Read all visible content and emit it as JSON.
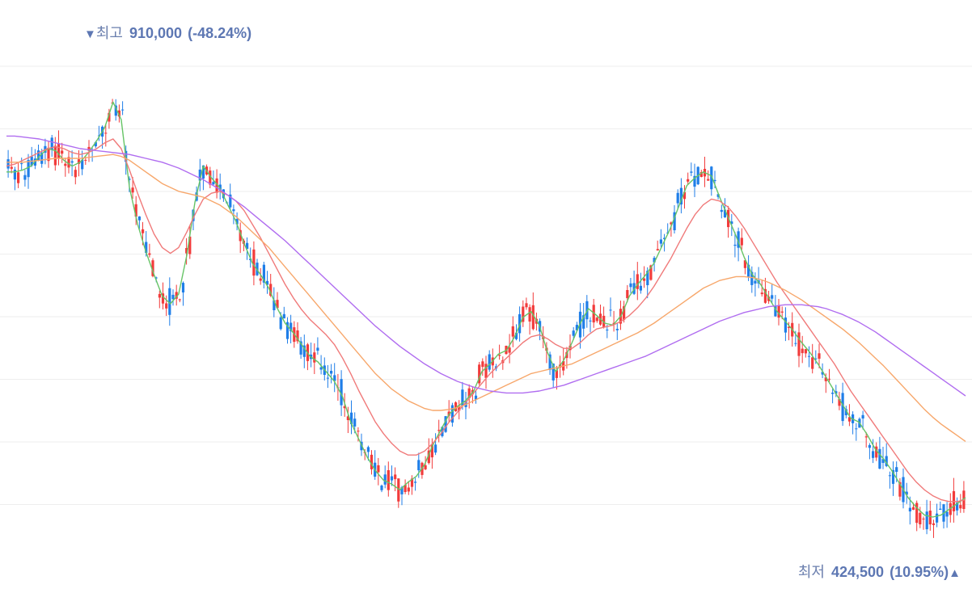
{
  "chart_data": {
    "type": "candlestick",
    "title": "",
    "xlabel": "",
    "ylabel": "",
    "ylim": [
      400000,
      950000
    ],
    "grid": true,
    "colors": {
      "up": "#f23b3b",
      "down": "#1f7ee8",
      "ma5": "#66c466",
      "ma20": "#f07a7a",
      "ma60": "#f7a76b",
      "ma120": "#b06df0",
      "grid": "#eeeeee",
      "annotation": "#5d77b3"
    },
    "high_marker": {
      "label": "최고",
      "value": "910,000",
      "change": "(-48.24%)",
      "marker": "▼"
    },
    "low_marker": {
      "label": "최저",
      "value": "424,500",
      "change": "(10.95%)",
      "marker": "▲"
    },
    "series": [
      {
        "key": "ma5",
        "values": [
          806000,
          806000,
          808000,
          812000,
          822000,
          830000,
          828000,
          818000,
          812000,
          816000,
          826000,
          838000,
          852000,
          878000,
          860000,
          790000,
          752000,
          724000,
          700000,
          678000,
          670000,
          680000,
          720000,
          775000,
          812000,
          800000,
          790000,
          772000,
          755000,
          732000,
          712000,
          700000,
          686000,
          666000,
          650000,
          640000,
          628000,
          616000,
          610000,
          600000,
          590000,
          574000,
          548000,
          530000,
          512000,
          498000,
          488000,
          484000,
          478000,
          486000,
          492000,
          504000,
          524000,
          540000,
          556000,
          564000,
          570000,
          580000,
          600000,
          608000,
          618000,
          622000,
          636000,
          656000,
          662000,
          648000,
          620000,
          600000,
          612000,
          630000,
          650000,
          665000,
          658000,
          650000,
          648000,
          658000,
          678000,
          690000,
          700000,
          712000,
          730000,
          748000,
          770000,
          792000,
          800000,
          806000,
          802000,
          780000,
          760000,
          740000,
          718000,
          700000,
          690000,
          676000,
          662000,
          652000,
          642000,
          630000,
          620000,
          608000,
          594000,
          580000,
          566000,
          552000,
          548000,
          535000,
          520000,
          510000,
          498000,
          484000,
          470000,
          460000,
          452000,
          450000,
          452000,
          458000,
          464000,
          470000
        ]
      },
      {
        "key": "ma20",
        "values": [
          812000,
          814000,
          818000,
          822000,
          826000,
          830000,
          832000,
          830000,
          826000,
          824000,
          826000,
          830000,
          836000,
          840000,
          830000,
          808000,
          784000,
          762000,
          742000,
          728000,
          722000,
          728000,
          744000,
          762000,
          778000,
          784000,
          786000,
          782000,
          776000,
          766000,
          752000,
          738000,
          722000,
          706000,
          690000,
          676000,
          664000,
          654000,
          646000,
          638000,
          628000,
          614000,
          598000,
          580000,
          564000,
          548000,
          536000,
          526000,
          518000,
          514000,
          514000,
          518000,
          526000,
          536000,
          548000,
          558000,
          568000,
          578000,
          588000,
          598000,
          606000,
          614000,
          622000,
          630000,
          636000,
          638000,
          634000,
          628000,
          624000,
          624000,
          630000,
          638000,
          644000,
          646000,
          648000,
          652000,
          658000,
          666000,
          676000,
          688000,
          702000,
          716000,
          732000,
          748000,
          762000,
          772000,
          778000,
          776000,
          770000,
          760000,
          748000,
          734000,
          720000,
          706000,
          692000,
          680000,
          668000,
          656000,
          644000,
          632000,
          620000,
          608000,
          594000,
          580000,
          568000,
          556000,
          544000,
          532000,
          520000,
          508000,
          496000,
          486000,
          478000,
          472000,
          468000,
          466000,
          466000,
          468000
        ]
      },
      {
        "key": "ma60",
        "values": [
          816000,
          816000,
          816000,
          817000,
          818000,
          819000,
          820000,
          820000,
          820000,
          820000,
          821000,
          822000,
          823000,
          824000,
          822000,
          818000,
          812000,
          806000,
          800000,
          794000,
          790000,
          786000,
          784000,
          782000,
          780000,
          776000,
          772000,
          766000,
          760000,
          752000,
          744000,
          736000,
          728000,
          718000,
          708000,
          698000,
          688000,
          678000,
          668000,
          658000,
          648000,
          638000,
          628000,
          618000,
          608000,
          598000,
          590000,
          582000,
          576000,
          570000,
          566000,
          562000,
          560000,
          560000,
          561000,
          563000,
          566000,
          570000,
          574000,
          578000,
          582000,
          586000,
          590000,
          594000,
          598000,
          600000,
          602000,
          604000,
          606000,
          608000,
          612000,
          616000,
          620000,
          624000,
          628000,
          632000,
          636000,
          640000,
          645000,
          650000,
          656000,
          662000,
          668000,
          674000,
          680000,
          686000,
          690000,
          694000,
          696000,
          698000,
          698000,
          697000,
          695000,
          692000,
          688000,
          684000,
          679000,
          674000,
          668000,
          662000,
          656000,
          650000,
          644000,
          637000,
          630000,
          622000,
          614000,
          606000,
          597000,
          588000,
          579000,
          570000,
          561000,
          553000,
          546000,
          540000,
          534000,
          528000
        ]
      },
      {
        "key": "ma120",
        "values": [
          843000,
          843000,
          842000,
          841000,
          840000,
          838000,
          836000,
          834000,
          832000,
          830000,
          829000,
          828000,
          827000,
          826000,
          825000,
          824000,
          822000,
          820000,
          818000,
          816000,
          813000,
          810000,
          806000,
          802000,
          798000,
          793000,
          788000,
          782000,
          776000,
          770000,
          763000,
          756000,
          749000,
          742000,
          735000,
          727000,
          719000,
          711000,
          703000,
          695000,
          687000,
          679000,
          671000,
          663000,
          655000,
          647000,
          640000,
          633000,
          626000,
          620000,
          614000,
          608000,
          603000,
          598000,
          594000,
          590000,
          587000,
          584000,
          582000,
          580000,
          579000,
          578000,
          578000,
          578000,
          579000,
          580000,
          582000,
          584000,
          586000,
          589000,
          592000,
          595000,
          598000,
          601000,
          604000,
          607000,
          610000,
          613000,
          616000,
          620000,
          624000,
          628000,
          632000,
          636000,
          640000,
          644000,
          648000,
          652000,
          655000,
          658000,
          661000,
          663000,
          665000,
          667000,
          668000,
          669000,
          669000,
          669000,
          668000,
          667000,
          665000,
          662000,
          659000,
          655000,
          651000,
          646000,
          641000,
          635000,
          629000,
          623000,
          617000,
          611000,
          605000,
          599000,
          593000,
          587000,
          581000,
          575000
        ]
      }
    ]
  }
}
